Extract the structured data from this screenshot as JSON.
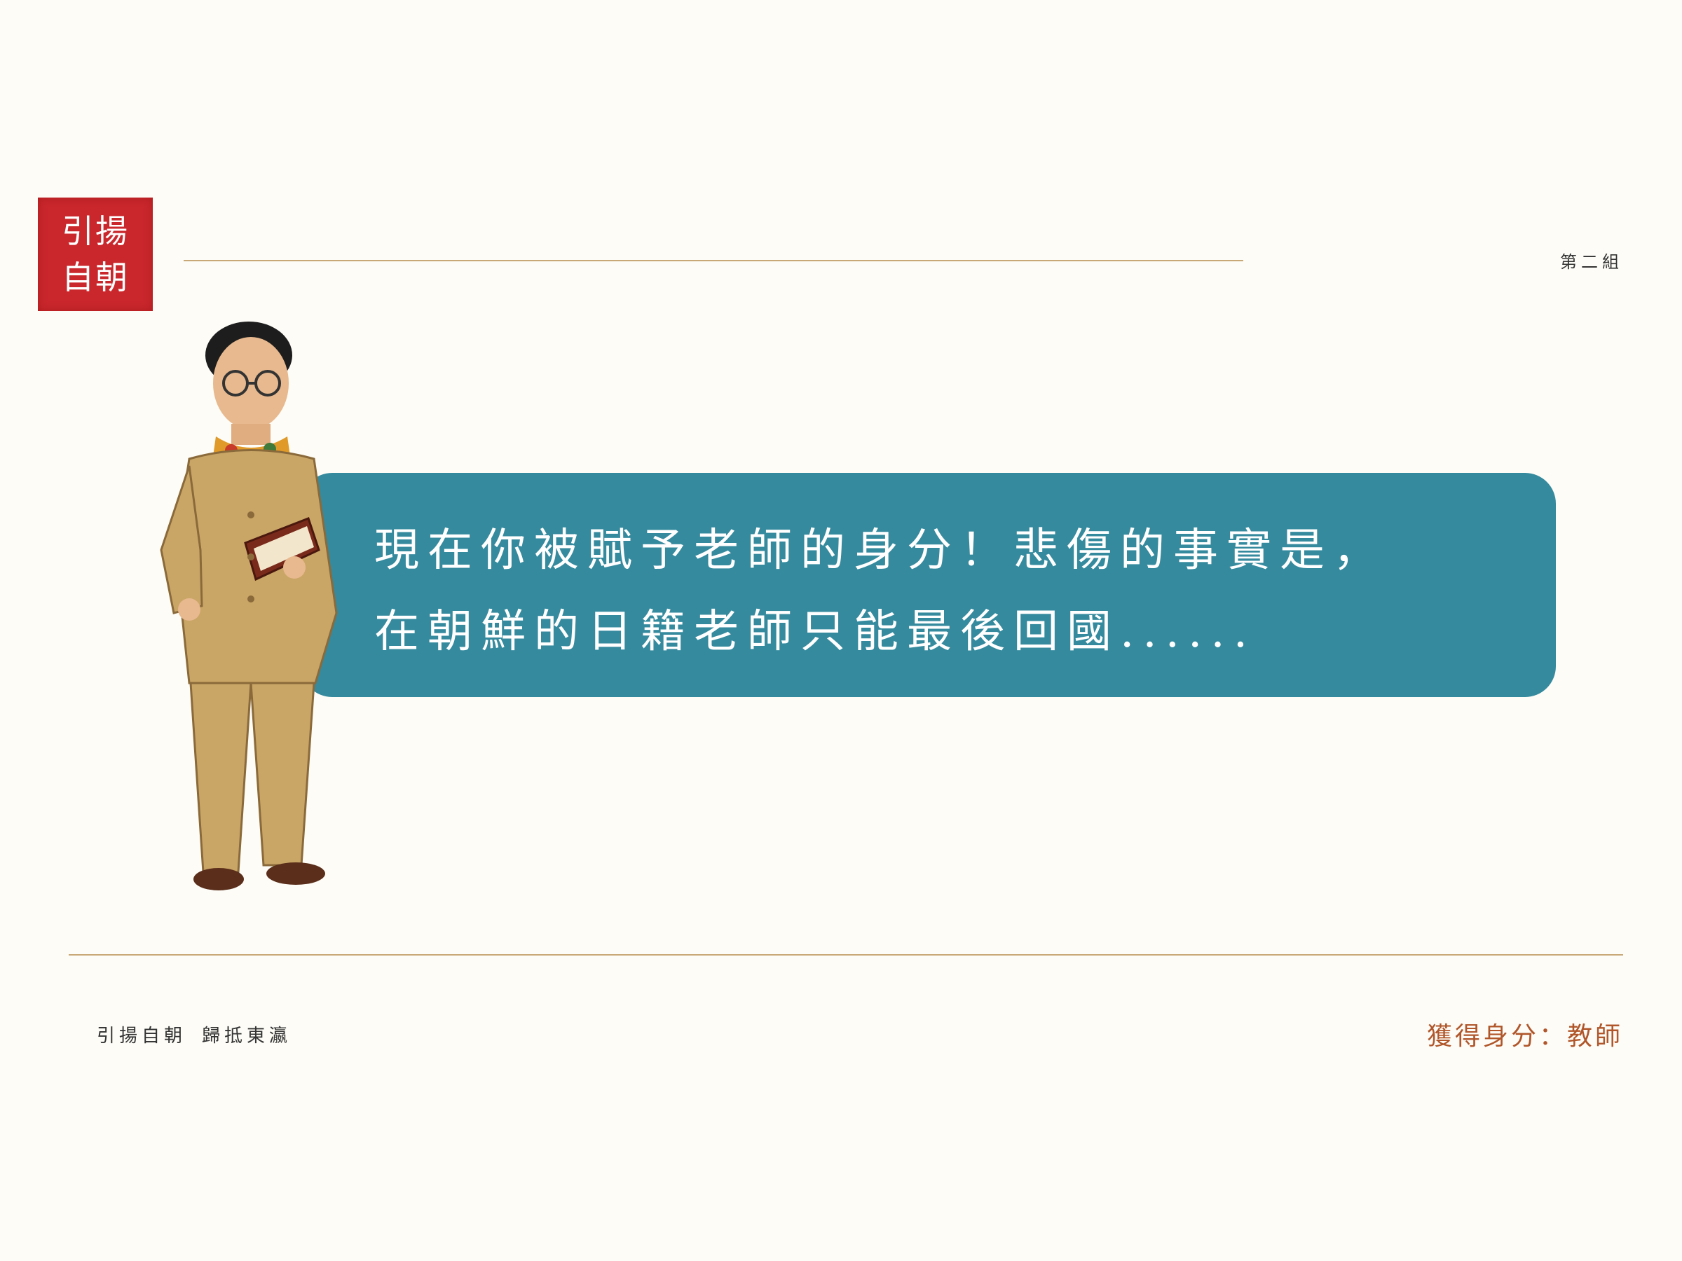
{
  "seal": {
    "line1": "引揚",
    "line2": "自朝"
  },
  "header": {
    "group": "第二組"
  },
  "bubble": {
    "line1": "現在你被賦予老師的身分！悲傷的事實是，",
    "line2": "在朝鮮的日籍老師只能最後回國......"
  },
  "footer": {
    "left_a": "引揚自朝",
    "left_b": "歸抵東瀛",
    "right": "獲得身分：教師"
  },
  "colors": {
    "background": "#fdfcf7",
    "seal": "#c9272c",
    "bubble": "#358a9e",
    "rule": "#c9a878",
    "accent_text": "#b0562a"
  }
}
